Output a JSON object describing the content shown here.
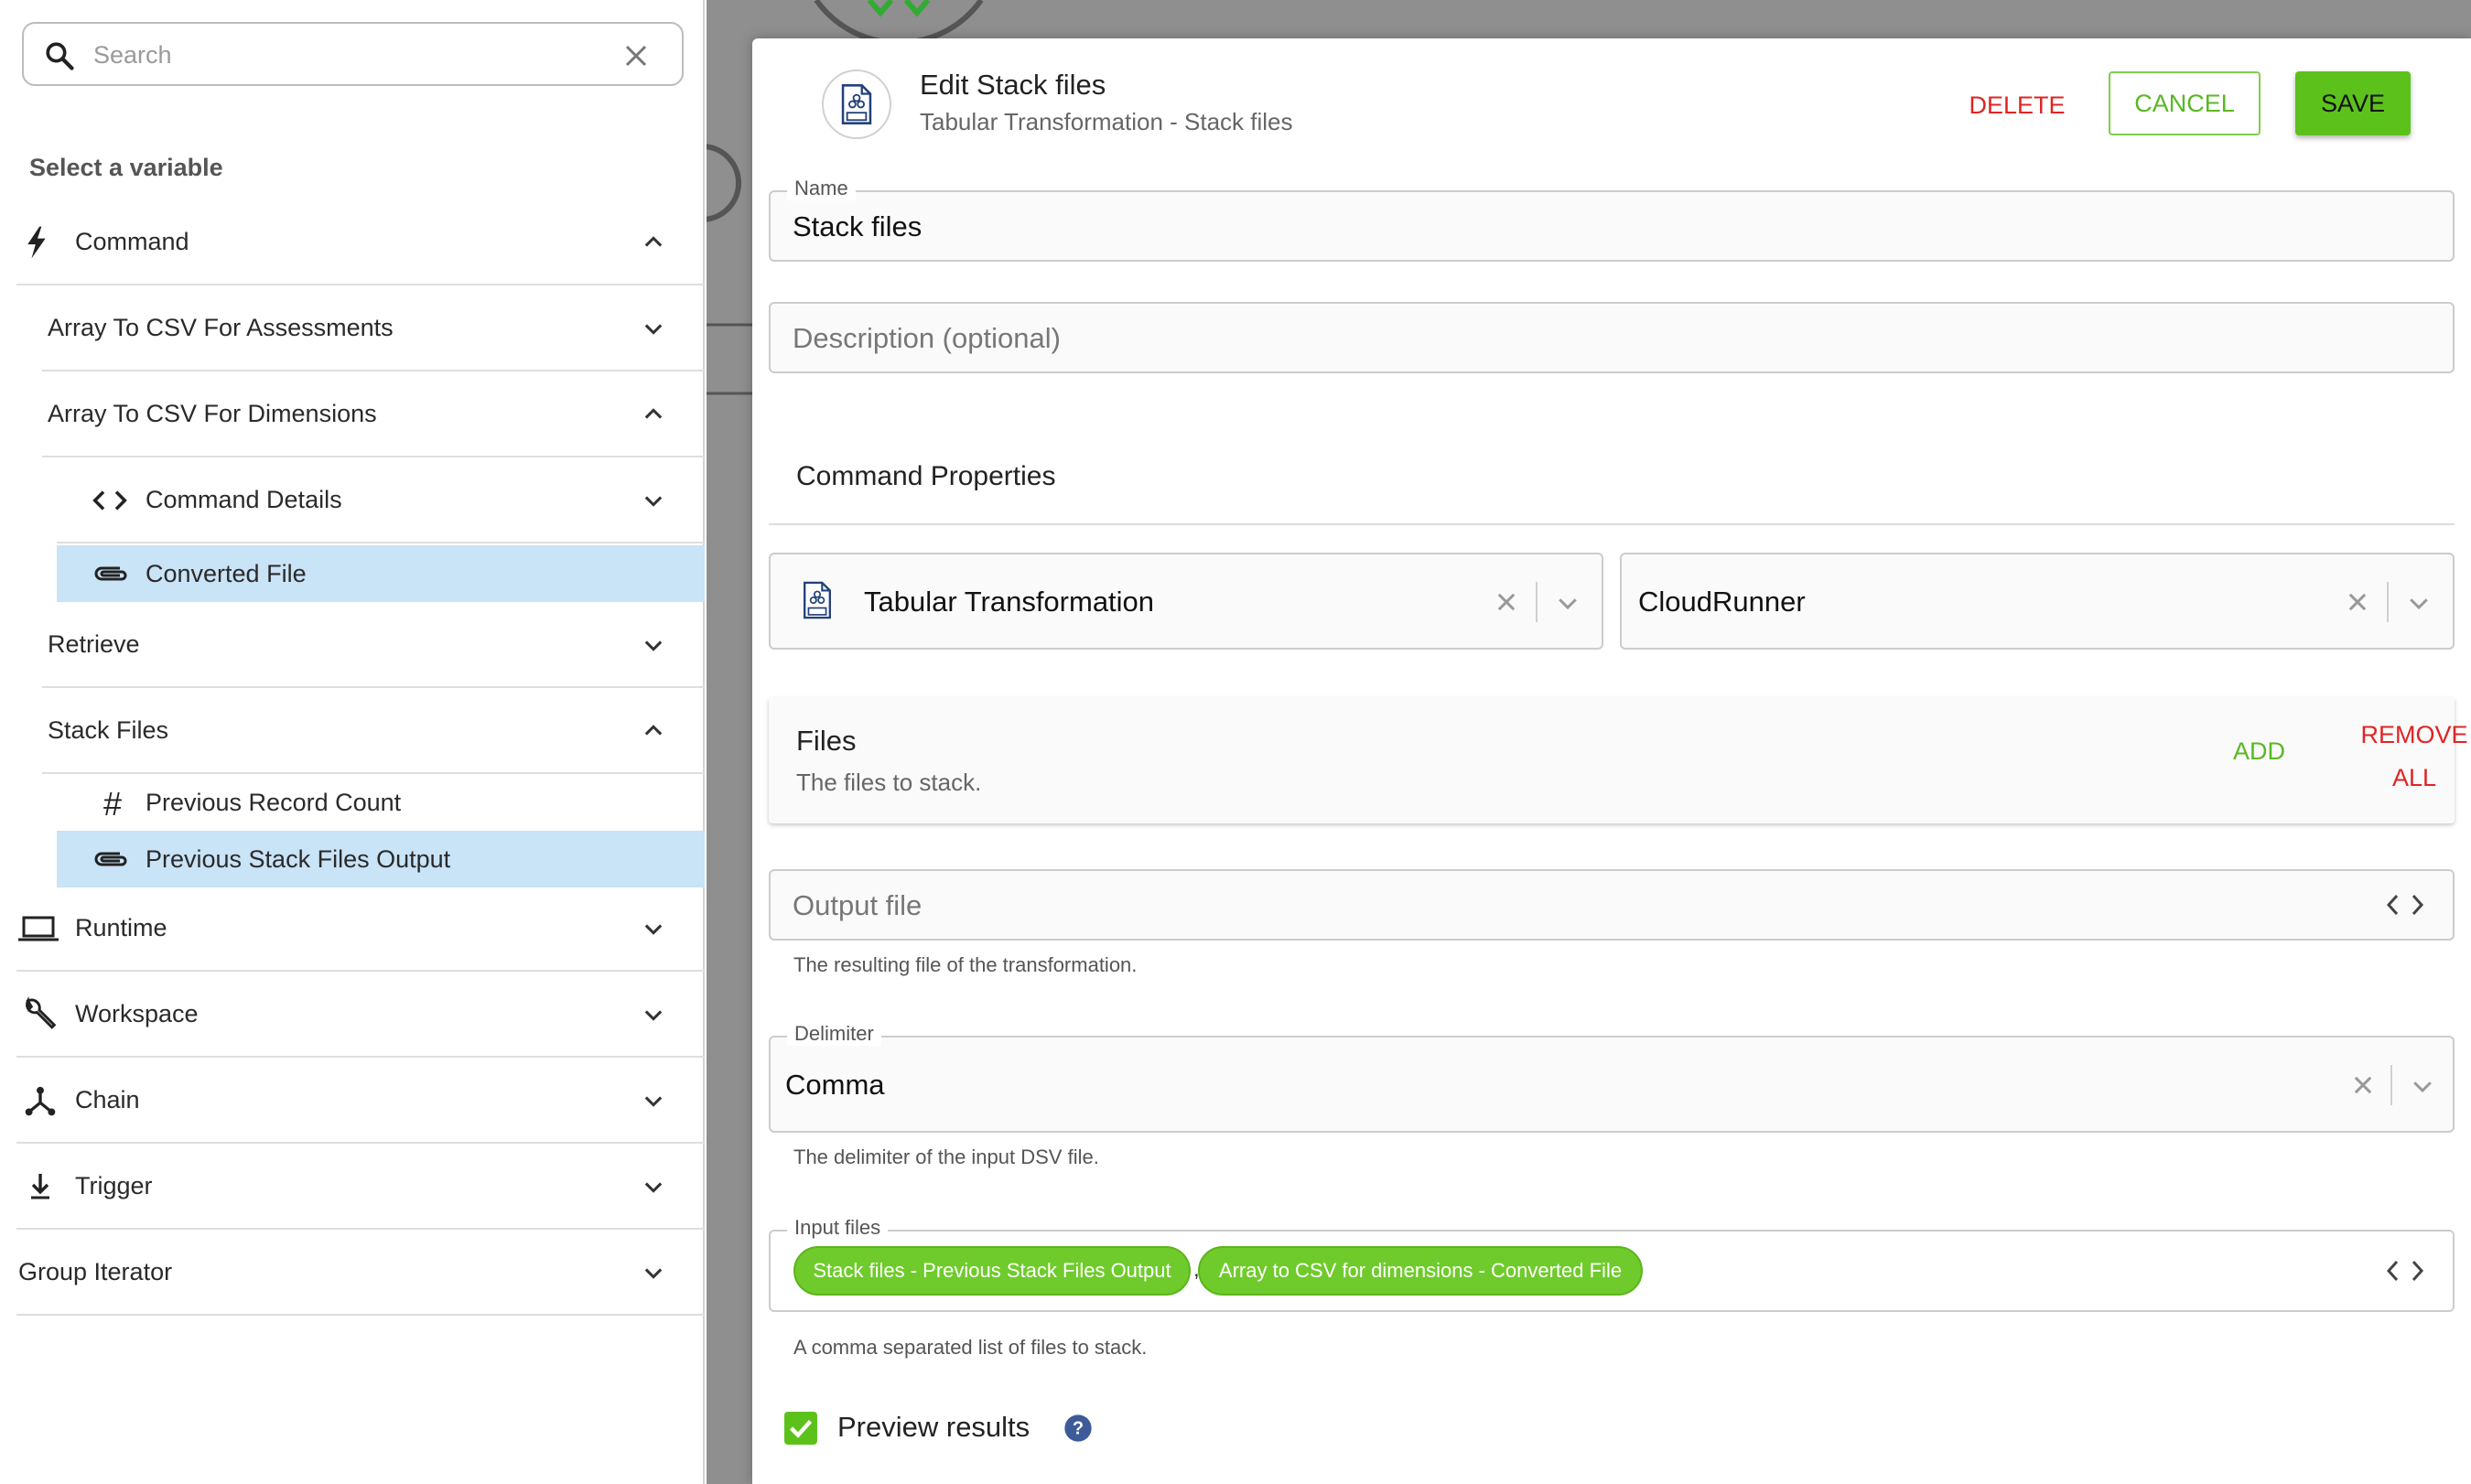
{
  "search": {
    "placeholder": "Search",
    "value": ""
  },
  "sidebar": {
    "heading": "Select a variable",
    "items": [
      {
        "label": "Command",
        "icon": "lightning-icon",
        "expanded": true
      },
      {
        "label": "Array To CSV For Assessments",
        "expanded": false
      },
      {
        "label": "Array To CSV For Dimensions",
        "expanded": true
      },
      {
        "label": "Command Details",
        "icon": "code-icon",
        "expanded": false
      },
      {
        "label": "Converted File",
        "icon": "paperclip-icon",
        "selected": true
      },
      {
        "label": "Retrieve",
        "expanded": false
      },
      {
        "label": "Stack Files",
        "expanded": true
      },
      {
        "label": "Previous Record Count",
        "icon": "hash-icon"
      },
      {
        "label": "Previous Stack Files Output",
        "icon": "paperclip-icon",
        "selected": true
      },
      {
        "label": "Runtime",
        "icon": "laptop-icon",
        "expanded": false
      },
      {
        "label": "Workspace",
        "icon": "wrench-icon",
        "expanded": false
      },
      {
        "label": "Chain",
        "icon": "chain-icon",
        "expanded": false
      },
      {
        "label": "Trigger",
        "icon": "trigger-icon",
        "expanded": false
      },
      {
        "label": "Group Iterator",
        "expanded": false
      }
    ]
  },
  "editor": {
    "title": "Edit Stack files",
    "subtitle": "Tabular Transformation - Stack files",
    "delete_label": "DELETE",
    "cancel_label": "CANCEL",
    "save_label": "SAVE",
    "name": {
      "label": "Name",
      "value": "Stack files"
    },
    "description": {
      "placeholder": "Description (optional)"
    },
    "command_properties": {
      "heading": "Command Properties",
      "command_select": "Tabular Transformation",
      "runner_select": "CloudRunner"
    },
    "files": {
      "title": "Files",
      "description": "The files to stack.",
      "add_label": "ADD",
      "remove_all_label": "REMOVE ALL"
    },
    "output_file": {
      "placeholder": "Output file",
      "help": "The resulting file of the transformation."
    },
    "delimiter": {
      "label": "Delimiter",
      "value": "Comma",
      "help": "The delimiter of the input DSV file."
    },
    "input_files": {
      "label": "Input files",
      "chips": [
        "Stack files - Previous Stack Files Output",
        "Array to CSV for dimensions - Converted File"
      ],
      "separator": ",",
      "help": "A comma separated list of files to stack."
    },
    "preview": {
      "label": "Preview results",
      "checked": true
    }
  },
  "colors": {
    "accent_green": "#5cc21b",
    "danger_red": "#e02424",
    "selection_blue": "#c9e3f7",
    "overlay_gray": "#8f8f8f"
  }
}
